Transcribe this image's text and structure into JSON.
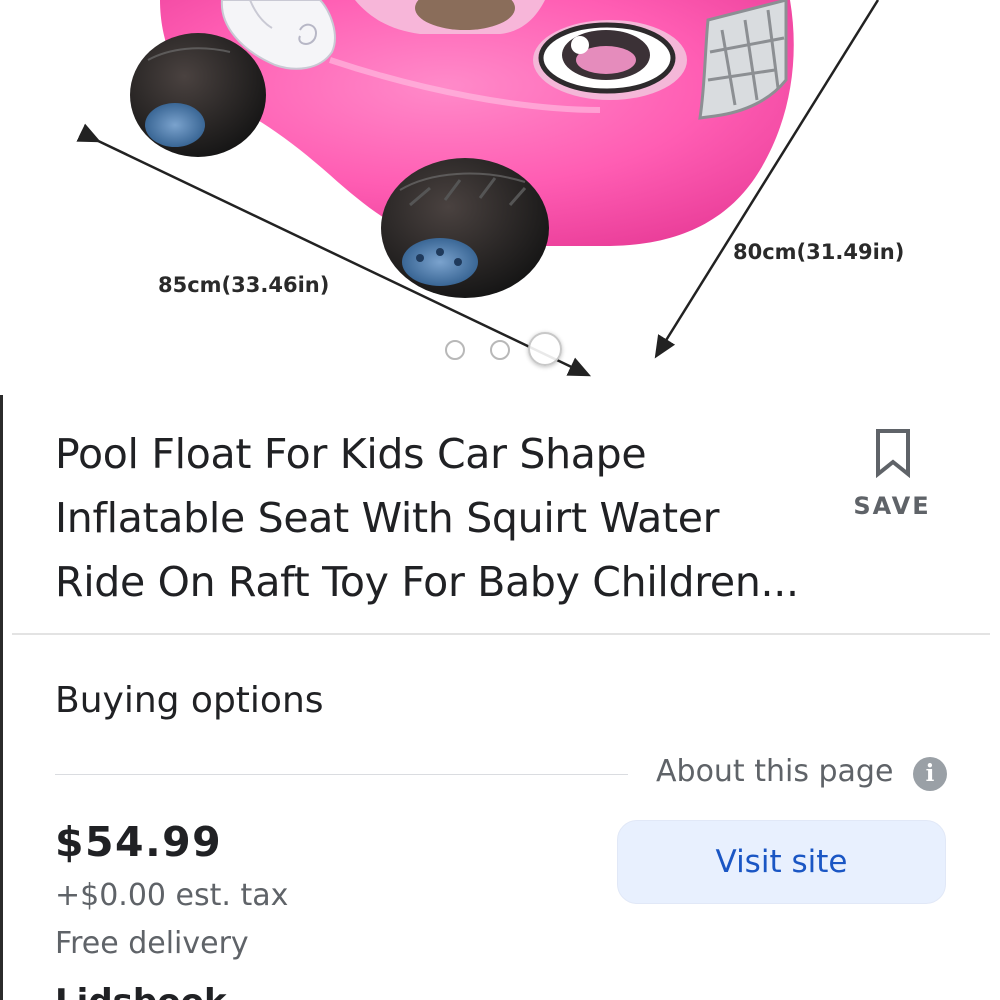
{
  "product_image": {
    "dimension_width_label": "85cm(33.46in)",
    "dimension_depth_label": "80cm(31.49in)",
    "carousel_total": 3,
    "carousel_active": 3
  },
  "product": {
    "title_lines": [
      "Pool Float For Kids Car Shape",
      "Inflatable Seat With Squirt Water",
      "Ride On Raft Toy For Baby Children..."
    ],
    "save_label": "SAVE"
  },
  "buying_options": {
    "heading": "Buying options",
    "about_label": "About this page",
    "about_icon": "info-icon",
    "offer": {
      "price": "$54.99",
      "tax": "+$0.00 est. tax",
      "delivery": "Free delivery",
      "visit_label": "Visit site",
      "seller_partial": "Lidsbook"
    }
  },
  "colors": {
    "accent": "#1a56c4",
    "button_bg": "#e8f0fe",
    "product_pink": "#ff5fb4"
  }
}
